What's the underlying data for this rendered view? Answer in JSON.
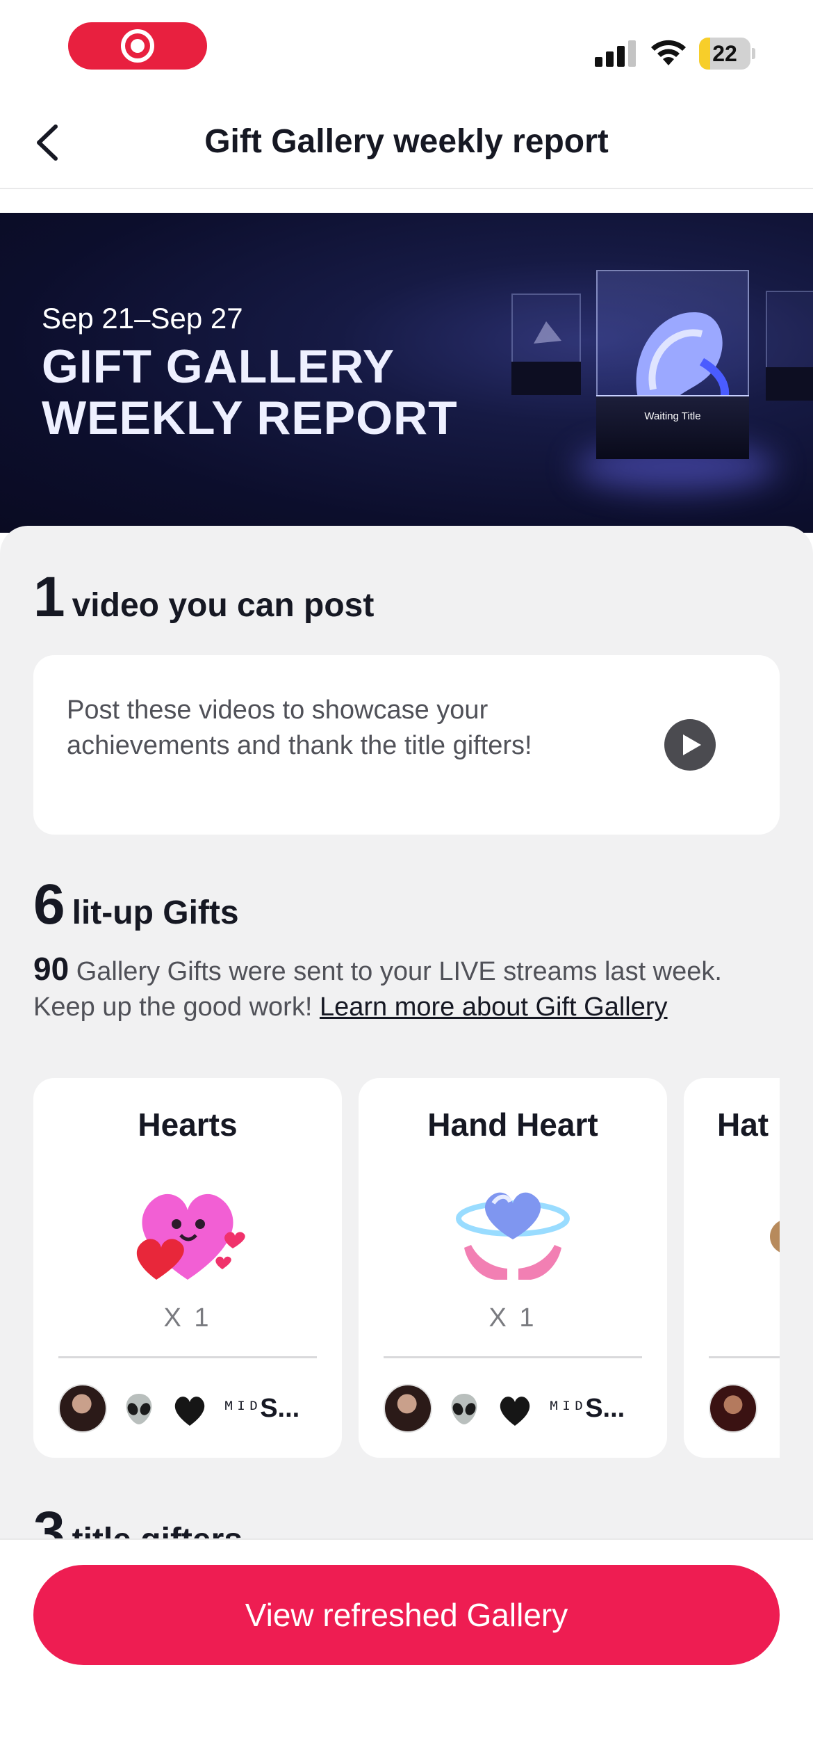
{
  "status_bar": {
    "battery_level": "22",
    "recording_color": "#e8203f",
    "battery_color": "#f7ce2a"
  },
  "header": {
    "title": "Gift Gallery weekly report",
    "back_icon": "chevron-left-icon"
  },
  "banner": {
    "date_range": "Sep 21–Sep 27",
    "title_line1": "GIFT GALLERY",
    "title_line2": "WEEKLY REPORT",
    "cube_label": "Waiting Title"
  },
  "videos_section": {
    "count": "1",
    "title": "video you can post",
    "description": "Post these videos to showcase your achievements and thank the title gifters!"
  },
  "gifts_section": {
    "count": "6",
    "title": "lit-up Gifts",
    "sent_count": "90",
    "sent_text": " Gallery Gifts were sent to your LIVE streams last week. Keep up the good work! ",
    "learn_more_link": "Learn more about Gift Gallery",
    "cards": [
      {
        "name": "Hearts",
        "icon": "hearts-gift-icon",
        "quantity": "X 1",
        "gifter_name_prefix": "ᴹᴵᴰ",
        "gifter_name_tail": "S..."
      },
      {
        "name": "Hand Heart",
        "icon": "hand-heart-gift-icon",
        "quantity": "X 1",
        "gifter_name_prefix": "ᴹᴵᴰ",
        "gifter_name_tail": "S..."
      },
      {
        "name": "Hat",
        "icon": "hat-gift-icon"
      }
    ]
  },
  "gifters_section": {
    "count": "3",
    "title": "title gifters"
  },
  "cta": {
    "label": "View refreshed Gallery",
    "color": "#ee1d52"
  }
}
